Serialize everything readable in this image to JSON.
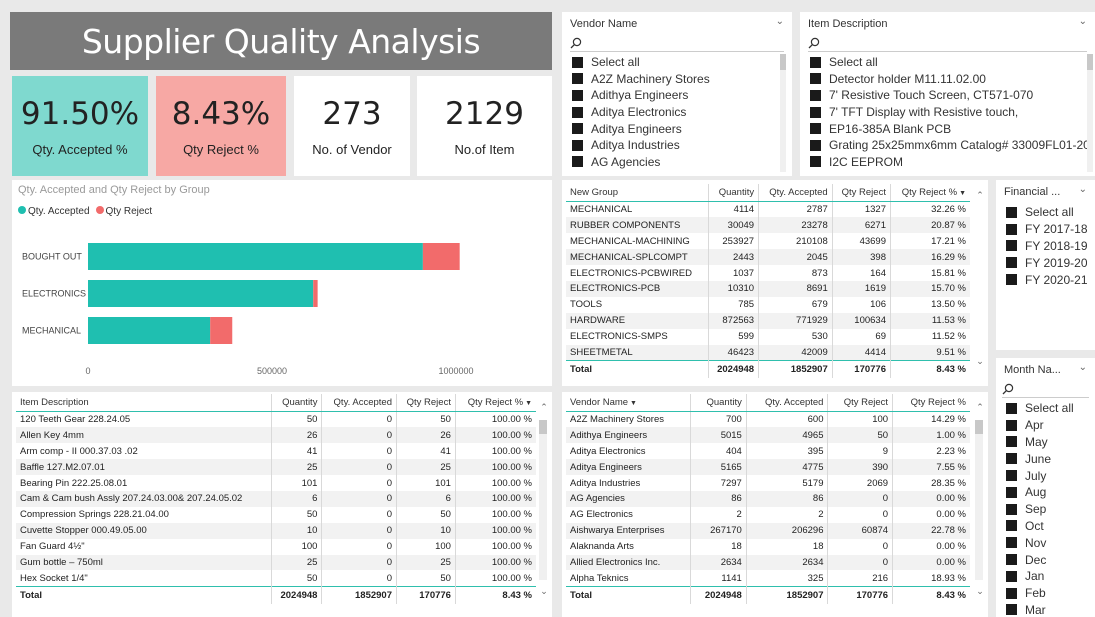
{
  "title": "Supplier Quality Analysis",
  "kpis": [
    {
      "value": "91.50%",
      "label": "Qty. Accepted %",
      "bg": "#7fd9cf"
    },
    {
      "value": "8.43%",
      "label": "Qty Reject %",
      "bg": "#f7a8a4"
    },
    {
      "value": "273",
      "label": "No. of Vendor",
      "bg": "#ffffff"
    },
    {
      "value": "2129",
      "label": "No.of Item",
      "bg": "#ffffff"
    }
  ],
  "vendor_slicer": {
    "header": "Vendor Name",
    "items": [
      "Select all",
      "A2Z Machinery Stores",
      "Adithya Engineers",
      "Aditya Electronics",
      "Aditya Engineers",
      "Aditya Industries",
      "AG Agencies"
    ]
  },
  "item_slicer": {
    "header": "Item Description",
    "items": [
      "Select all",
      "Detector holder M11.11.02.00",
      "7' Resistive Touch Screen, CT571-070",
      "7' TFT Display with Resistive touch,",
      "EP16-385A Blank PCB",
      "Grating 25x25mmx6mm Catalog# 33009FL01-20...",
      "I2C EEPROM"
    ]
  },
  "financial_slicer": {
    "header": "Financial ...",
    "items": [
      "Select all",
      "FY 2017-18",
      "FY 2018-19",
      "FY 2019-20",
      "FY 2020-21"
    ]
  },
  "month_slicer": {
    "header": "Month Na...",
    "items": [
      "Select all",
      "Apr",
      "May",
      "June",
      "July",
      "Aug",
      "Sep",
      "Oct",
      "Nov",
      "Dec",
      "Jan",
      "Feb",
      "Mar"
    ]
  },
  "colors": {
    "accepted": "#1fbfb0",
    "reject": "#f26b6b",
    "accent": "#2fbfad"
  },
  "chart_data": {
    "type": "bar",
    "title": "Qty. Accepted and Qty Reject by Group",
    "categories": [
      "BOUGHT OUT",
      "ELECTRONICS",
      "MECHANICAL"
    ],
    "series": [
      {
        "name": "Qty. Accepted",
        "values": [
          910000,
          612000,
          332000
        ]
      },
      {
        "name": "Qty Reject",
        "values": [
          100000,
          12000,
          60000
        ]
      }
    ],
    "xticks": [
      "0",
      "500000",
      "1000000"
    ],
    "xlim": [
      0,
      1000000
    ],
    "stacked": true,
    "orientation": "horizontal",
    "legend": "top-left"
  },
  "group_table": {
    "headers": [
      "New Group",
      "Quantity",
      "Qty. Accepted",
      "Qty Reject",
      "Qty Reject %"
    ],
    "rows": [
      [
        "MECHANICAL",
        "4114",
        "2787",
        "1327",
        "32.26 %"
      ],
      [
        "RUBBER COMPONENTS",
        "30049",
        "23278",
        "6271",
        "20.87 %"
      ],
      [
        "MECHANICAL-MACHINING",
        "253927",
        "210108",
        "43699",
        "17.21 %"
      ],
      [
        "MECHANICAL-SPLCOMPT",
        "2443",
        "2045",
        "398",
        "16.29 %"
      ],
      [
        "ELECTRONICS-PCBWIRED",
        "1037",
        "873",
        "164",
        "15.81 %"
      ],
      [
        "ELECTRONICS-PCB",
        "10310",
        "8691",
        "1619",
        "15.70 %"
      ],
      [
        "TOOLS",
        "785",
        "679",
        "106",
        "13.50 %"
      ],
      [
        "HARDWARE",
        "872563",
        "771929",
        "100634",
        "11.53 %"
      ],
      [
        "ELECTRONICS-SMPS",
        "599",
        "530",
        "69",
        "11.52 %"
      ],
      [
        "SHEETMETAL",
        "46423",
        "42009",
        "4414",
        "9.51 %"
      ]
    ],
    "total": [
      "Total",
      "2024948",
      "1852907",
      "170776",
      "8.43 %"
    ]
  },
  "item_table": {
    "headers": [
      "Item Description",
      "Quantity",
      "Qty. Accepted",
      "Qty Reject",
      "Qty Reject %"
    ],
    "rows": [
      [
        "120 Teeth Gear 228.24.05",
        "50",
        "0",
        "50",
        "100.00 %"
      ],
      [
        "Allen Key 4mm",
        "26",
        "0",
        "26",
        "100.00 %"
      ],
      [
        "Arm comp - II 000.37.03 .02",
        "41",
        "0",
        "41",
        "100.00 %"
      ],
      [
        "Baffle 127.M2.07.01",
        "25",
        "0",
        "25",
        "100.00 %"
      ],
      [
        "Bearing Pin 222.25.08.01",
        "101",
        "0",
        "101",
        "100.00 %"
      ],
      [
        "Cam & Cam bush Assly 207.24.03.00& 207.24.05.02",
        "6",
        "0",
        "6",
        "100.00 %"
      ],
      [
        "Compression Springs 228.21.04.00",
        "50",
        "0",
        "50",
        "100.00 %"
      ],
      [
        "Cuvette Stopper 000.49.05.00",
        "10",
        "0",
        "10",
        "100.00 %"
      ],
      [
        "Fan Guard 4½\"",
        "100",
        "0",
        "100",
        "100.00 %"
      ],
      [
        "Gum bottle – 750ml",
        "25",
        "0",
        "25",
        "100.00 %"
      ],
      [
        "Hex Socket 1/4\"",
        "50",
        "0",
        "50",
        "100.00 %"
      ]
    ],
    "total": [
      "Total",
      "2024948",
      "1852907",
      "170776",
      "8.43 %"
    ]
  },
  "vendor_table": {
    "headers": [
      "Vendor Name",
      "Quantity",
      "Qty. Accepted",
      "Qty Reject",
      "Qty Reject %"
    ],
    "rows": [
      [
        "A2Z Machinery Stores",
        "700",
        "600",
        "100",
        "14.29 %"
      ],
      [
        "Adithya Engineers",
        "5015",
        "4965",
        "50",
        "1.00 %"
      ],
      [
        "Aditya Electronics",
        "404",
        "395",
        "9",
        "2.23 %"
      ],
      [
        "Aditya Engineers",
        "5165",
        "4775",
        "390",
        "7.55 %"
      ],
      [
        "Aditya Industries",
        "7297",
        "5179",
        "2069",
        "28.35 %"
      ],
      [
        "AG Agencies",
        "86",
        "86",
        "0",
        "0.00 %"
      ],
      [
        "AG Electronics",
        "2",
        "2",
        "0",
        "0.00 %"
      ],
      [
        "Aishwarya Enterprises",
        "267170",
        "206296",
        "60874",
        "22.78 %"
      ],
      [
        "Alaknanda Arts",
        "18",
        "18",
        "0",
        "0.00 %"
      ],
      [
        "Allied Electronics Inc.",
        "2634",
        "2634",
        "0",
        "0.00 %"
      ],
      [
        "Alpha Teknics",
        "1141",
        "325",
        "216",
        "18.93 %"
      ]
    ],
    "total": [
      "Total",
      "2024948",
      "1852907",
      "170776",
      "8.43 %"
    ]
  }
}
